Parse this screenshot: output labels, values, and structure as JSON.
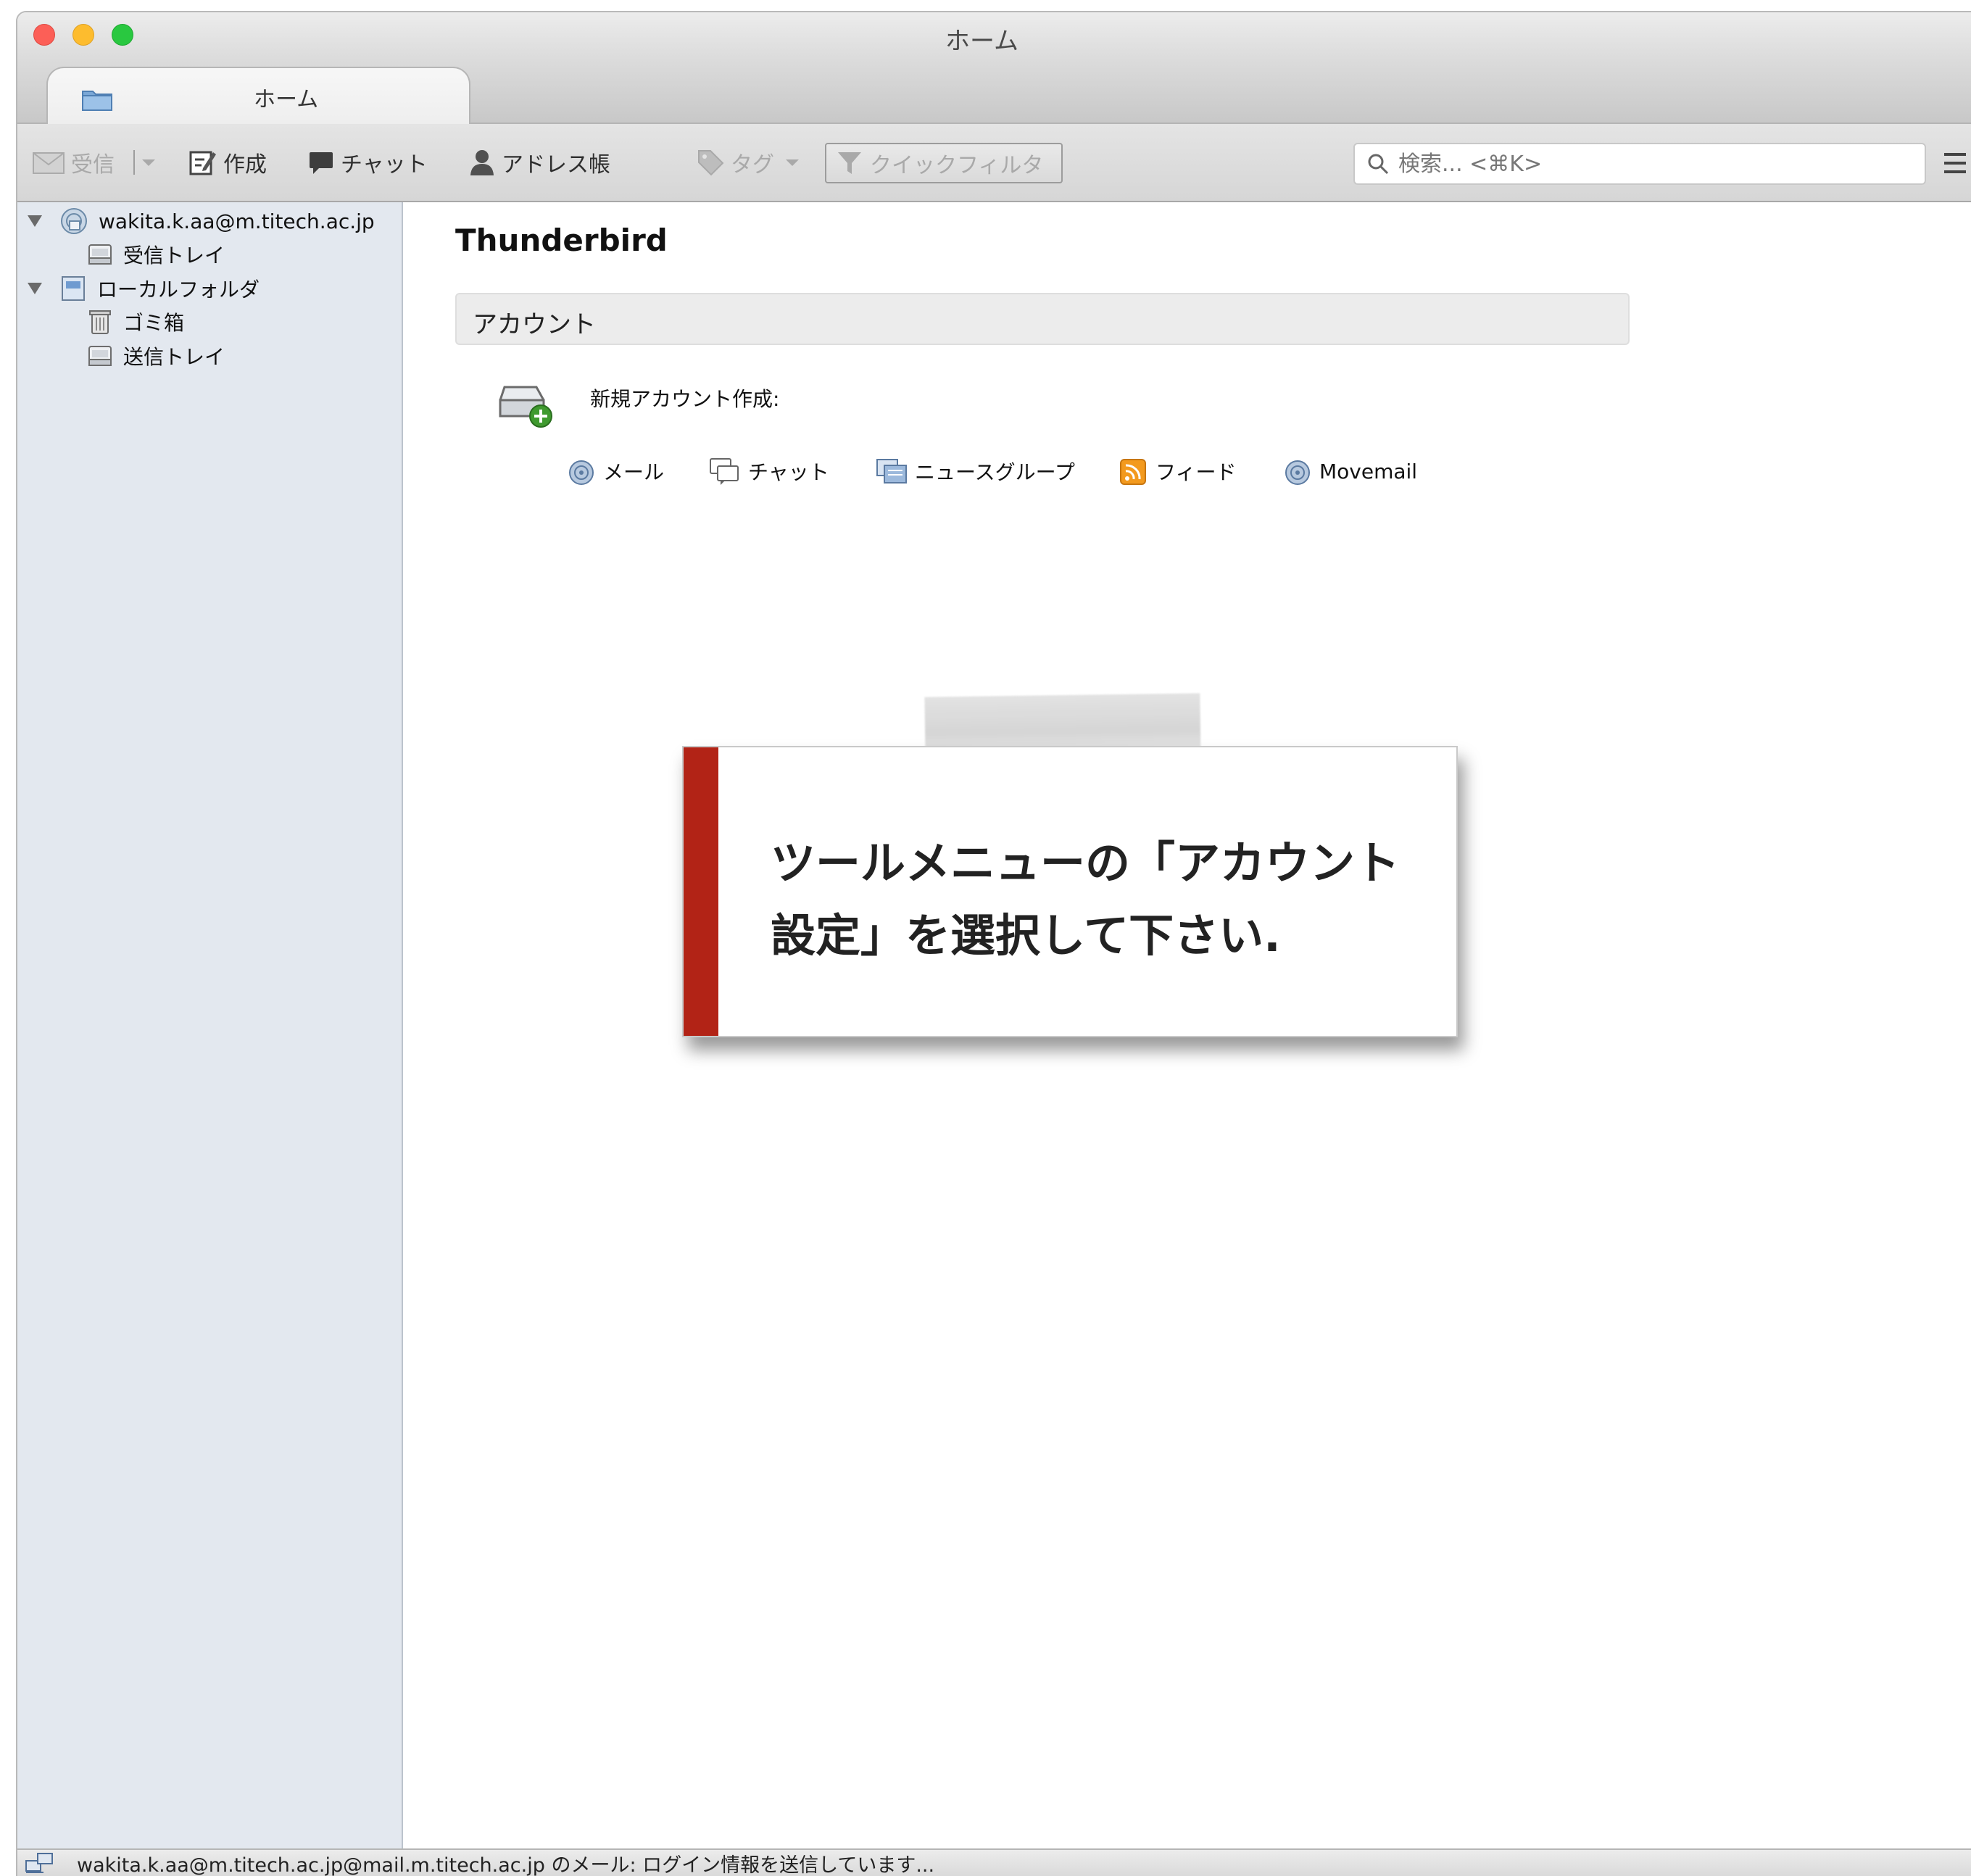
{
  "window": {
    "title": "ホーム"
  },
  "tabs": [
    {
      "label": "ホーム",
      "icon": "folder-icon",
      "active": true
    }
  ],
  "toolbar": {
    "get_mail_label": "受信",
    "write_label": "作成",
    "chat_label": "チャット",
    "address_book_label": "アドレス帳",
    "tag_label": "タグ",
    "quick_filter_label": "クイックフィルタ",
    "search_placeholder": "検索... <⌘K>"
  },
  "sidebar": {
    "items": [
      {
        "label": "wakita.k.aa@m.titech.ac.jp",
        "icon": "account-icon",
        "level": 0,
        "expanded": true
      },
      {
        "label": "受信トレイ",
        "icon": "inbox-icon",
        "level": 1
      },
      {
        "label": "ローカルフォルダ",
        "icon": "local-folders-icon",
        "level": 0,
        "expanded": true
      },
      {
        "label": "ゴミ箱",
        "icon": "trash-icon",
        "level": 1
      },
      {
        "label": "送信トレイ",
        "icon": "outbox-icon",
        "level": 1
      }
    ]
  },
  "main": {
    "title": "Thunderbird",
    "accounts_header": "アカウント",
    "new_account_label": "新規アカウント作成:",
    "account_options": [
      {
        "label": "メール",
        "icon": "mail-icon"
      },
      {
        "label": "チャット",
        "icon": "chat-icon"
      },
      {
        "label": "ニュースグループ",
        "icon": "newsgroup-icon"
      },
      {
        "label": "フィード",
        "icon": "feed-icon"
      },
      {
        "label": "Movemail",
        "icon": "movemail-icon"
      }
    ]
  },
  "callout": {
    "line1": "ツールメニューの「アカウント",
    "line2": "設定」を選択して下さい."
  },
  "statusbar": {
    "text": "wakita.k.aa@m.titech.ac.jp@mail.m.titech.ac.jp のメール: ログイン情報を送信しています..."
  },
  "colors": {
    "callout_accent": "#b22316",
    "sidebar_bg": "#e3e8ef",
    "feed_orange": "#f39a1e"
  }
}
